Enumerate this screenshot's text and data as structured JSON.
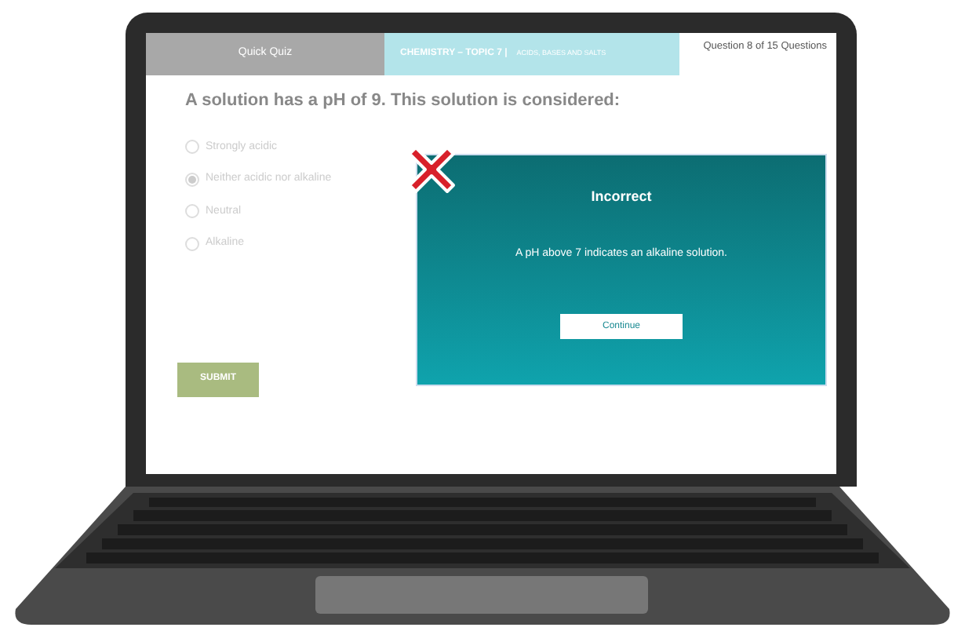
{
  "header": {
    "quiz_title": "Quick Quiz",
    "topic": "CHEMISTRY – TOPIC 7 |",
    "subtopic": "ACIDS, BASES AND SALTS",
    "progress": "Question 8 of 15 Questions"
  },
  "question": "A solution has a pH of 9. This solution is considered:",
  "options": [
    {
      "label": "Strongly acidic",
      "selected": false
    },
    {
      "label": "Neither acidic nor alkaline",
      "selected": true
    },
    {
      "label": "Neutral",
      "selected": false
    },
    {
      "label": "Alkaline",
      "selected": false
    }
  ],
  "submit_button": "SUBMIT",
  "feedback": {
    "title": "Incorrect",
    "message": "A pH above 7 indicates an alkaline solution.",
    "button": "Continue"
  }
}
